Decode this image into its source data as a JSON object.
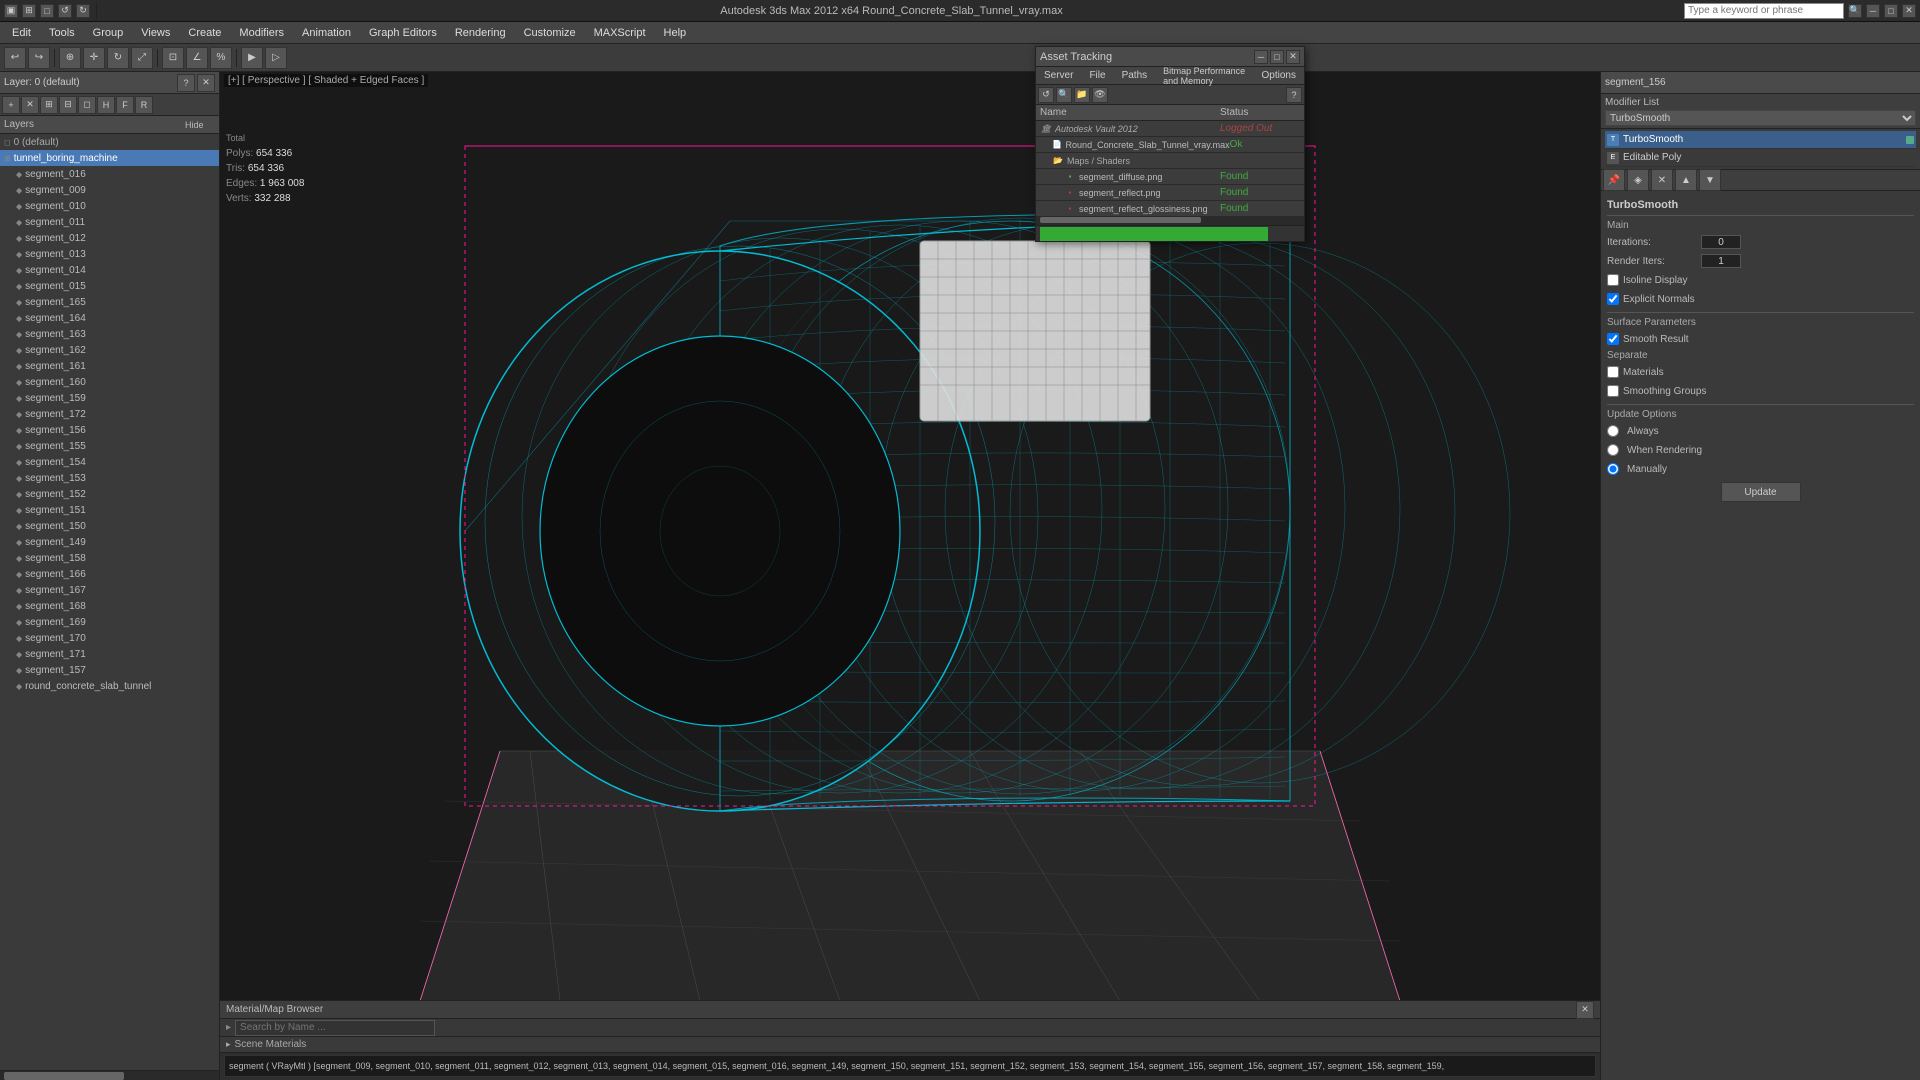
{
  "titlebar": {
    "title": "Autodesk 3ds Max 2012 x64    Round_Concrete_Slab_Tunnel_vray.max",
    "search_placeholder": "Type a keyword or phrase",
    "min_btn": "─",
    "max_btn": "□",
    "close_btn": "✕"
  },
  "menubar": {
    "items": [
      "Edit",
      "Tools",
      "Group",
      "Views",
      "Create",
      "Modifiers",
      "Animation",
      "Graph Editors",
      "Rendering",
      "Customize",
      "MAXScript",
      "Help"
    ]
  },
  "viewport": {
    "label": "[+] [ Perspective ] [ Shaded + Edged Faces ]",
    "stats": {
      "polys_label": "Polys:",
      "polys_val": "654 336",
      "tris_label": "Tris:",
      "tris_val": "654 336",
      "edges_label": "Edges:",
      "edges_val": "1 963 008",
      "verts_label": "Verts:",
      "verts_val": "332 288"
    }
  },
  "layers_panel": {
    "title": "Layer: 0 (default)",
    "help_icon": "?",
    "close_icon": "✕",
    "columns": {
      "layers": "Layers",
      "hide": "Hide",
      "extra": ""
    },
    "items": [
      {
        "name": "0 (default)",
        "type": "default",
        "indent": 0
      },
      {
        "name": "tunnel_boring_machine",
        "type": "group",
        "indent": 0,
        "selected": true
      },
      {
        "name": "segment_016",
        "type": "mesh",
        "indent": 1
      },
      {
        "name": "segment_009",
        "type": "mesh",
        "indent": 1
      },
      {
        "name": "segment_010",
        "type": "mesh",
        "indent": 1
      },
      {
        "name": "segment_011",
        "type": "mesh",
        "indent": 1
      },
      {
        "name": "segment_012",
        "type": "mesh",
        "indent": 1
      },
      {
        "name": "segment_013",
        "type": "mesh",
        "indent": 1
      },
      {
        "name": "segment_014",
        "type": "mesh",
        "indent": 1
      },
      {
        "name": "segment_015",
        "type": "mesh",
        "indent": 1
      },
      {
        "name": "segment_165",
        "type": "mesh",
        "indent": 1
      },
      {
        "name": "segment_164",
        "type": "mesh",
        "indent": 1
      },
      {
        "name": "segment_163",
        "type": "mesh",
        "indent": 1
      },
      {
        "name": "segment_162",
        "type": "mesh",
        "indent": 1
      },
      {
        "name": "segment_161",
        "type": "mesh",
        "indent": 1
      },
      {
        "name": "segment_160",
        "type": "mesh",
        "indent": 1
      },
      {
        "name": "segment_159",
        "type": "mesh",
        "indent": 1
      },
      {
        "name": "segment_172",
        "type": "mesh",
        "indent": 1
      },
      {
        "name": "segment_156",
        "type": "mesh",
        "indent": 1
      },
      {
        "name": "segment_155",
        "type": "mesh",
        "indent": 1
      },
      {
        "name": "segment_154",
        "type": "mesh",
        "indent": 1
      },
      {
        "name": "segment_153",
        "type": "mesh",
        "indent": 1
      },
      {
        "name": "segment_152",
        "type": "mesh",
        "indent": 1
      },
      {
        "name": "segment_151",
        "type": "mesh",
        "indent": 1
      },
      {
        "name": "segment_150",
        "type": "mesh",
        "indent": 1
      },
      {
        "name": "segment_149",
        "type": "mesh",
        "indent": 1
      },
      {
        "name": "segment_158",
        "type": "mesh",
        "indent": 1
      },
      {
        "name": "segment_166",
        "type": "mesh",
        "indent": 1
      },
      {
        "name": "segment_167",
        "type": "mesh",
        "indent": 1
      },
      {
        "name": "segment_168",
        "type": "mesh",
        "indent": 1
      },
      {
        "name": "segment_169",
        "type": "mesh",
        "indent": 1
      },
      {
        "name": "segment_170",
        "type": "mesh",
        "indent": 1
      },
      {
        "name": "segment_171",
        "type": "mesh",
        "indent": 1
      },
      {
        "name": "segment_157",
        "type": "mesh",
        "indent": 1
      },
      {
        "name": "round_concrete_slab_tunnel",
        "type": "mesh",
        "indent": 1
      }
    ]
  },
  "asset_tracking": {
    "title": "Asset Tracking",
    "menu": [
      "Server",
      "File",
      "Paths",
      "Bitmap Performance and Memory",
      "Options"
    ],
    "columns": {
      "name": "Name",
      "status": "Status"
    },
    "rows": [
      {
        "name": "Autodesk Vault 2012",
        "type": "vault",
        "status": "Logged Out",
        "indent": 0
      },
      {
        "name": "Round_Concrete_Slab_Tunnel_vray.max",
        "type": "file",
        "status": "Ok",
        "indent": 1
      },
      {
        "name": "Maps / Shaders",
        "type": "maps",
        "status": "",
        "indent": 1
      },
      {
        "name": "segment_diffuse.png",
        "type": "mapfile",
        "status": "Found",
        "indent": 2,
        "error": false
      },
      {
        "name": "segment_reflect.png",
        "type": "mapfile",
        "status": "Found",
        "indent": 2,
        "error": true
      },
      {
        "name": "segment_reflect_glossiness.png",
        "type": "mapfile",
        "status": "Found",
        "indent": 2,
        "error": true
      }
    ]
  },
  "right_panel": {
    "selected_object": "segment_156",
    "modifier_list_label": "Modifier List",
    "modifiers": [
      {
        "name": "TurboSmooth",
        "active": true
      },
      {
        "name": "Editable Poly",
        "active": false
      }
    ],
    "turbosmooth": {
      "section": "TurboSmooth",
      "main_label": "Main",
      "iterations_label": "Iterations:",
      "iterations_val": "0",
      "render_iters_label": "Render Iters:",
      "render_iters_val": "1",
      "isoline_display_label": "Isoline Display",
      "explicit_normals_label": "Explicit Normals",
      "surface_params_label": "Surface Parameters",
      "smooth_result_label": "Smooth Result",
      "smooth_result_checked": true,
      "separate_label": "Separate",
      "materials_label": "Materials",
      "smoothing_groups_label": "Smoothing Groups",
      "update_options_label": "Update Options",
      "always_label": "Always",
      "when_rendering_label": "When Rendering",
      "manually_label": "Manually",
      "manually_selected": true,
      "update_btn": "Update"
    }
  },
  "material_browser": {
    "title": "Material/Map Browser",
    "search_placeholder": "Search by Name ...",
    "scene_materials_label": "Scene Materials",
    "materials_strip": "segment ( VRayMtl ) [segment_009, segment_010, segment_011, segment_012, segment_013, segment_014, segment_015, segment_016, segment_149, segment_150, segment_151, segment_152, segment_153, segment_154, segment_155, segment_156, segment_157, segment_158, segment_159,"
  }
}
